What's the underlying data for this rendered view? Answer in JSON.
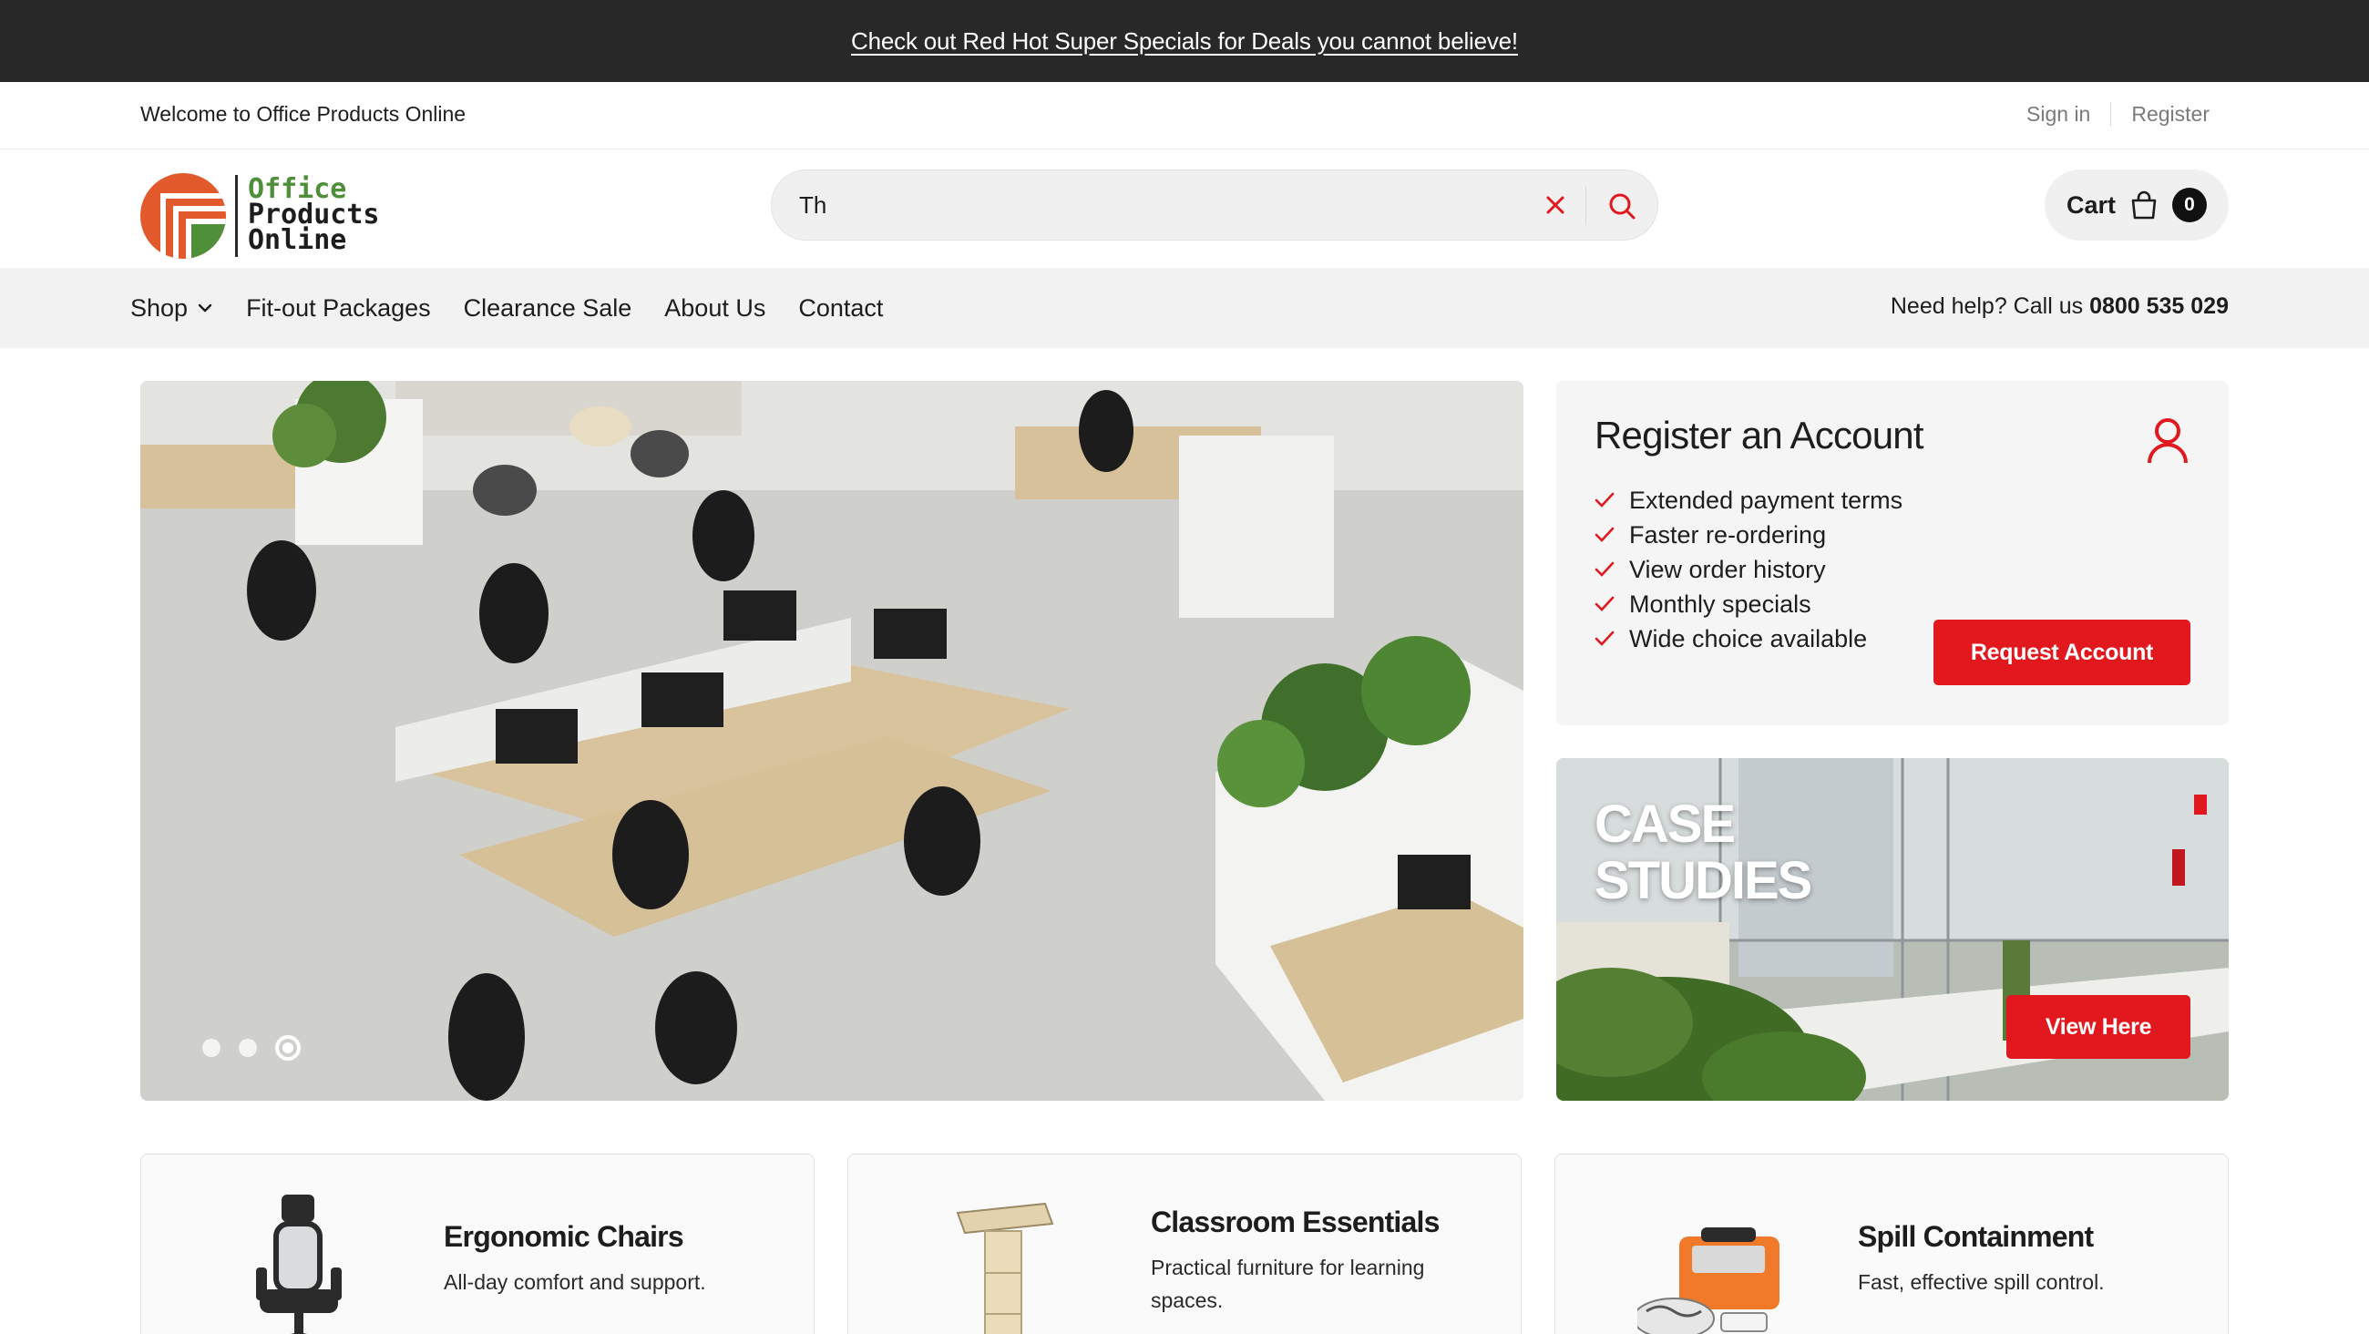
{
  "announcement": {
    "text": "Check out Red Hot Super Specials for Deals you cannot believe!"
  },
  "utility": {
    "welcome": "Welcome to Office Products Online",
    "sign_in": "Sign in",
    "register": "Register"
  },
  "logo": {
    "line1": "Office",
    "line2": "Products",
    "line3": "Online"
  },
  "search": {
    "value": "Th"
  },
  "cart": {
    "label": "Cart",
    "count": "0"
  },
  "nav": {
    "items": [
      {
        "label": "Shop",
        "has_dropdown": true
      },
      {
        "label": "Fit-out Packages"
      },
      {
        "label": "Clearance Sale"
      },
      {
        "label": "About Us"
      },
      {
        "label": "Contact"
      }
    ],
    "help_text": "Need help? Call us",
    "help_phone": "0800 535 029"
  },
  "hero": {
    "slide_count": 3,
    "active_slide": 3
  },
  "register_card": {
    "title": "Register an Account",
    "benefits": [
      "Extended payment terms",
      "Faster re-ordering",
      "View order history",
      "Monthly specials",
      "Wide choice available"
    ],
    "button": "Request Account"
  },
  "case_studies": {
    "title_line1": "CASE",
    "title_line2": "STUDIES",
    "button": "View Here"
  },
  "categories": [
    {
      "title": "Ergonomic Chairs",
      "description": "All-day comfort and support."
    },
    {
      "title": "Classroom Essentials",
      "description": "Practical furniture for learning spaces."
    },
    {
      "title": "Spill Containment",
      "description": "Fast, effective spill control."
    }
  ],
  "colors": {
    "accent": "#e1191e",
    "announcement_bg": "#282828",
    "nav_bg": "#f2f2f2",
    "logo_green": "#4f8f3a"
  }
}
